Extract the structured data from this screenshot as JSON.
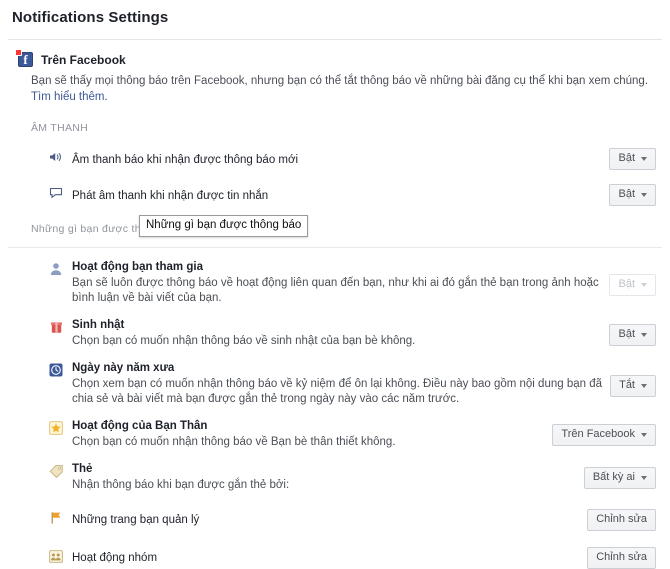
{
  "header": {
    "title": "Notifications Settings"
  },
  "facebook_block": {
    "icon": "facebook-badge-icon",
    "title": "Trên Facebook",
    "description_before_link": "Bạn sẽ thấy mọi thông báo trên Facebook, nhưng bạn có thể tắt thông báo về những bài đăng cụ thể khi bạn xem chúng. ",
    "link_label": "Tìm hiểu thêm",
    "description_after_link": "."
  },
  "sound_section": {
    "label": "ÂM THANH",
    "rows": [
      {
        "icon": "speaker-icon",
        "title": "Âm thanh báo khi nhận được thông báo mới",
        "control": {
          "type": "dropdown",
          "label": "Bật",
          "disabled": false
        }
      },
      {
        "icon": "chat-bubble-icon",
        "title": "Phát âm thanh khi nhận được tin nhắn",
        "control": {
          "type": "dropdown",
          "label": "Bật",
          "disabled": false
        }
      }
    ]
  },
  "notify_section": {
    "label": "Những gì bạn được thông báo",
    "tooltip": "Những gì bạn được thông báo",
    "rows": [
      {
        "icon": "person-icon",
        "title": "Hoạt động bạn tham gia",
        "subtitle": "Bạn sẽ luôn được thông báo về hoạt động liên quan đến bạn, như khi ai đó gắn thẻ bạn trong ảnh hoặc bình luận về bài viết của bạn.",
        "control": {
          "type": "dropdown",
          "label": "Bật",
          "disabled": true
        }
      },
      {
        "icon": "gift-icon",
        "title": "Sinh nhật",
        "subtitle": "Chọn bạn có muốn nhận thông báo về sinh nhật của bạn bè không.",
        "control": {
          "type": "dropdown",
          "label": "Bật",
          "disabled": false
        }
      },
      {
        "icon": "clock-icon",
        "title": "Ngày này năm xưa",
        "subtitle": "Chọn xem bạn có muốn nhận thông báo về kỷ niệm để ôn lại không. Điều này bao gồm nội dung bạn đã chia sẻ và bài viết mà bạn được gắn thẻ trong ngày này vào các năm trước.",
        "control": {
          "type": "dropdown",
          "label": "Tắt",
          "disabled": false
        }
      },
      {
        "icon": "star-icon",
        "title": "Hoạt động của Bạn Thân",
        "subtitle": "Chọn bạn có muốn nhận thông báo về Bạn bè thân thiết không.",
        "control": {
          "type": "dropdown",
          "label": "Trên Facebook",
          "disabled": false
        }
      },
      {
        "icon": "tag-icon",
        "title": "Thẻ",
        "subtitle": "Nhận thông báo khi bạn được gắn thẻ bởi:",
        "control": {
          "type": "dropdown",
          "label": "Bất kỳ ai",
          "disabled": false
        }
      },
      {
        "icon": "flag-icon",
        "title": "Những trang bạn quản lý",
        "subtitle": "",
        "control": {
          "type": "button",
          "label": "Chỉnh sửa",
          "disabled": false
        }
      },
      {
        "icon": "group-icon",
        "title": "Hoạt động nhóm",
        "subtitle": "",
        "control": {
          "type": "button",
          "label": "Chỉnh sửa",
          "disabled": false
        }
      }
    ]
  },
  "colors": {
    "facebook_blue": "#3b5998",
    "text_primary": "#1d2129",
    "text_secondary": "#4b4f56",
    "text_muted": "#90949c",
    "border": "#ccd0d5"
  }
}
